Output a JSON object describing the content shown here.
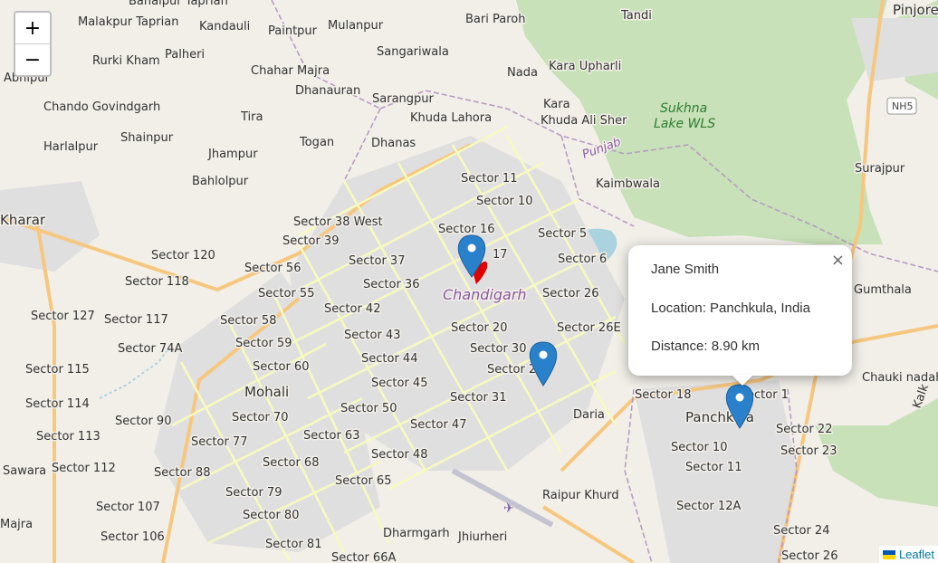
{
  "zoom": {
    "in_label": "+",
    "out_label": "−"
  },
  "popup": {
    "name": "Jane Smith",
    "location": "Location: Panchkula, India",
    "distance": "Distance: 8.90 km",
    "close_label": "×"
  },
  "attribution": {
    "label": "Leaflet",
    "flag_colors": [
      "#0057b7",
      "#ffd700"
    ]
  },
  "marker_color": "#2a81cb",
  "selected_marker_color": "#e00000",
  "map_labels": {
    "banalpur_taprian": "Banalpur Taprian",
    "malakpur_taprian": "Malakpur Taprian",
    "kandauli": "Kandauli",
    "mulanpur": "Mulanpur",
    "paintpur": "Paintpur",
    "palheri": "Palheri",
    "rurki_kham": "Rurki Kham",
    "abhipur": "Abhipur",
    "chahar_majra": "Chahar Majra",
    "dhanauran": "Dhanauran",
    "sangariwala": "Sangariwala",
    "bari_paroh": "Bari Paroh",
    "tandi": "Tandi",
    "pinjore": "Pinjore",
    "nada": "Nada",
    "kara_upharli": "Kara Upharli",
    "kara": "Kara",
    "khuda_ali_sher": "Khuda Ali Sher",
    "khuda_lahora": "Khuda Lahora",
    "sarangpur": "Sarangpur",
    "sukhna": "Sukhna",
    "lake_wls": "Lake WLS",
    "nh5": "NH5",
    "chando_govindgarh": "Chando Govindgarh",
    "tira": "Tira",
    "shainpur": "Shainpur",
    "harlalpur": "Harlalpur",
    "togan": "Togan",
    "dhanas": "Dhanas",
    "punjab": "Punjab",
    "surajpur": "Surajpur",
    "jhampur": "Jhampur",
    "bahlolpur": "Bahlolpur",
    "kaimbwala": "Kaimbwala",
    "sector_11": "Sector 11",
    "sector_10": "Sector 10",
    "kharar": "Kharar",
    "sector_38_west": "Sector 38 West",
    "sector_16": "Sector 16",
    "sector_5": "Sector 5",
    "sector_39": "Sector 39",
    "sector_17": "17",
    "sector_120": "Sector 120",
    "sector_56": "Sector 56",
    "sector_37": "Sector 37",
    "sector_6": "Sector 6",
    "sector_118": "Sector 118",
    "sector_36": "Sector 36",
    "chandigarh": "Chandigarh",
    "sector_26": "Sector 26",
    "gumthala": "Gumthala",
    "sector_55": "Sector 55",
    "sector_42": "Sector 42",
    "sector_127": "Sector 127",
    "sector_117": "Sector 117",
    "sector_58": "Sector 58",
    "sector_20": "Sector 20",
    "sector_26e": "Sector 26E",
    "sector_43": "Sector 43",
    "sector_74a": "Sector 74A",
    "sector_59": "Sector 59",
    "sector_30": "Sector 30",
    "chauki_nadah": "Chauki nadah",
    "sector_115": "Sector 115",
    "sector_44": "Sector 44",
    "sector_28": "Sector 2",
    "sector_60": "Sector 60",
    "sector_45": "Sector 45",
    "mohali": "Mohali",
    "sector_31": "Sector 31",
    "sector_18": "Sector 18",
    "sector_1": "ector 1",
    "sector_114": "Sector 114",
    "sector_50": "Sector 50",
    "daria": "Daria",
    "panchkula": "Panchkula",
    "sector_90": "Sector 90",
    "sector_70": "Sector 70",
    "sector_47": "Sector 47",
    "sector_22": "Sector 22",
    "sector_113": "Sector 113",
    "sector_63": "Sector 63",
    "sector_77": "Sector 77",
    "sector_10p": "Sector 10",
    "sector_23": "Sector 23",
    "sector_48": "Sector 48",
    "sawara": "Sawara",
    "sector_112": "Sector 112",
    "sector_68": "Sector 68",
    "sector_11p": "Sector 11",
    "sector_88": "Sector 88",
    "sector_65": "Sector 65",
    "sector_79": "Sector 79",
    "raipur_khurd": "Raipur Khurd",
    "sector_107": "Sector 107",
    "sector_12a": "Sector 12A",
    "sector_80": "Sector 80",
    "majra": "Majra",
    "dharmgarh": "Dharmgarh",
    "sector_106": "Sector 106",
    "jhiurheri": "Jhiurheri",
    "sector_24": "Sector 24",
    "sector_81": "Sector 81",
    "sector_66a": "Sector 66A",
    "sector_26p": "Sector 26",
    "kalka": "Kalk"
  }
}
